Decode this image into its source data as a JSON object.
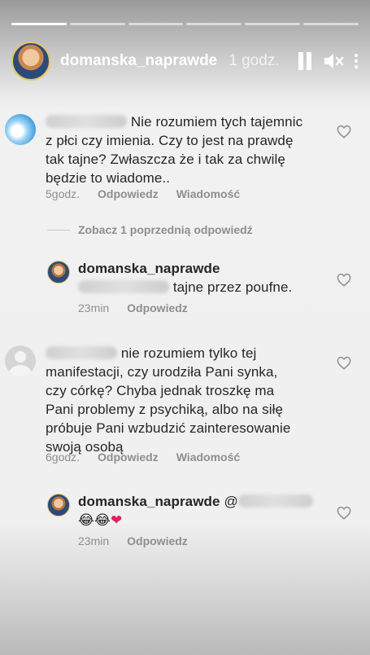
{
  "story": {
    "progress": [
      1,
      0,
      0,
      0,
      0,
      0
    ],
    "username": "domanska_naprawde",
    "time": "1 godz."
  },
  "comments": [
    {
      "text_lines": [
        "Nie rozumiem tych tajemnic",
        "z płci czy imienia. Czy to jest na prawdę",
        "tak tajne? Zwłaszcza że i tak za chwilę",
        "będzie to wiadome.."
      ],
      "time": "5godz.",
      "reply": "Odpowiedz",
      "message": "Wiadomość"
    },
    {
      "view_previous": "Zobacz 1 poprzednią odpowiedź"
    },
    {
      "username": "domanska_naprawde",
      "text": "tajne przez poufne.",
      "time": "23min",
      "reply": "Odpowiedz"
    },
    {
      "text_lines": [
        "nie rozumiem tylko tej",
        "manifestacji, czy urodziła Pani synka,",
        "czy córkę? Chyba jednak troszkę ma",
        "Pani problemy z psychiką, albo na siłę",
        "próbuje Pani wzbudzić zainteresowanie",
        "swoją osobą"
      ],
      "time": "6godz.",
      "reply": "Odpowiedz",
      "message": "Wiadomość"
    },
    {
      "username": "domanska_naprawde",
      "at": "@",
      "emojis": [
        "😂",
        "😂",
        "❤"
      ],
      "time": "23min",
      "reply": "Odpowiedz"
    }
  ]
}
